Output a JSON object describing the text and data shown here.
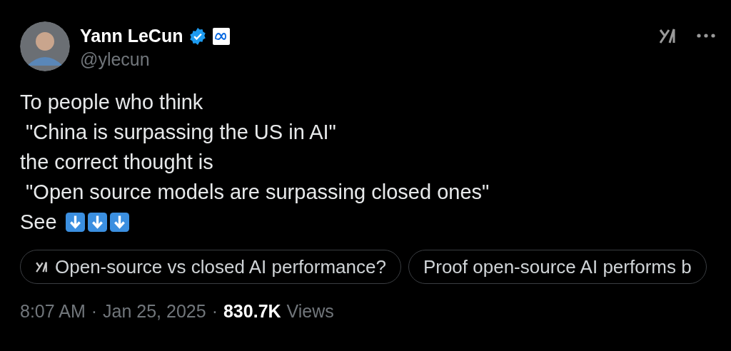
{
  "author": {
    "name": "Yann LeCun",
    "handle": "@ylecun",
    "verified": true
  },
  "body": {
    "lines": [
      "To people who think",
      " \"China is surpassing the US in AI\"",
      "the correct thought is",
      " \"Open source models are surpassing closed ones\"",
      "See"
    ]
  },
  "suggestions": [
    {
      "label": "Open-source vs closed AI performance?",
      "kind": "grok"
    },
    {
      "label": "Proof open-source AI performs b",
      "kind": "plain"
    }
  ],
  "footer": [
    {
      "kind": "time",
      "text": "8:07 AM"
    },
    {
      "kind": "separator",
      "text": "·"
    },
    {
      "kind": "date",
      "text": "Jan 25, 2025"
    },
    {
      "kind": "separator",
      "text": "·"
    },
    {
      "kind": "count",
      "text": "830.7K"
    },
    {
      "kind": "label",
      "text": "Views"
    }
  ]
}
